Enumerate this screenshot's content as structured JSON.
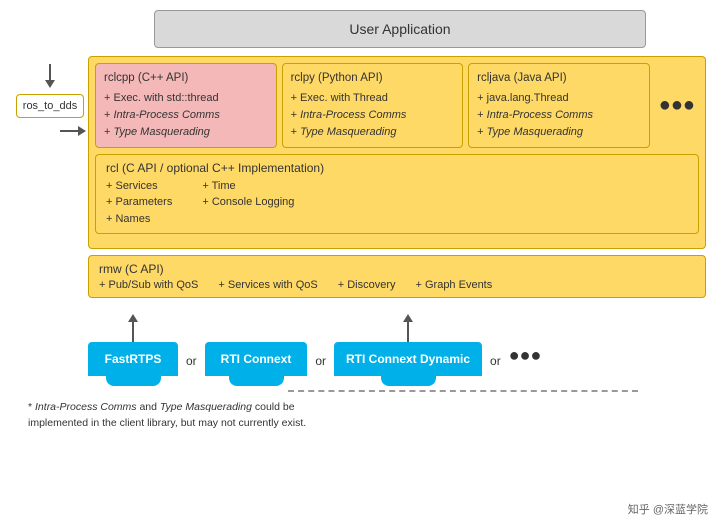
{
  "diagram": {
    "user_app": "User Application",
    "ros_to_dds": "ros_to_dds",
    "client_libs": {
      "rclcpp": {
        "title": "rclcpp (C++ API)",
        "features": [
          "+ Exec. with std::thread",
          "+ Intra-Process Comms",
          "+ Type Masquerading"
        ]
      },
      "rclpy": {
        "title": "rclpy (Python API)",
        "features": [
          "+ Exec. with Thread",
          "+ Intra-Process Comms",
          "+ Type Masquerading"
        ]
      },
      "rcljava": {
        "title": "rcljava (Java API)",
        "features": [
          "+ java.lang.Thread",
          "+ Intra-Process Comms",
          "+ Type Masquerading"
        ]
      }
    },
    "rcl": {
      "title": "rcl (C API / optional C++ Implementation)",
      "features_col1": [
        "+ Services",
        "+ Parameters",
        "+ Names"
      ],
      "features_col2": [
        "+ Time",
        "+ Console Logging"
      ]
    },
    "rmw": {
      "title": "rmw (C API)",
      "features": [
        "+ Pub/Sub with QoS",
        "+ Services with QoS",
        "+ Discovery",
        "+ Graph Events"
      ]
    },
    "dds_impls": [
      "FastRTPS",
      "RTI Connext",
      "RTI Connext Dynamic"
    ],
    "or_label": "or",
    "ellipsis": "●●●",
    "footnote_line1": "* Intra-Process Comms and Type Masquerading could be",
    "footnote_line2": "implemented in the client library, but may not currently exist.",
    "watermark": "知乎 @深蓝学院"
  }
}
